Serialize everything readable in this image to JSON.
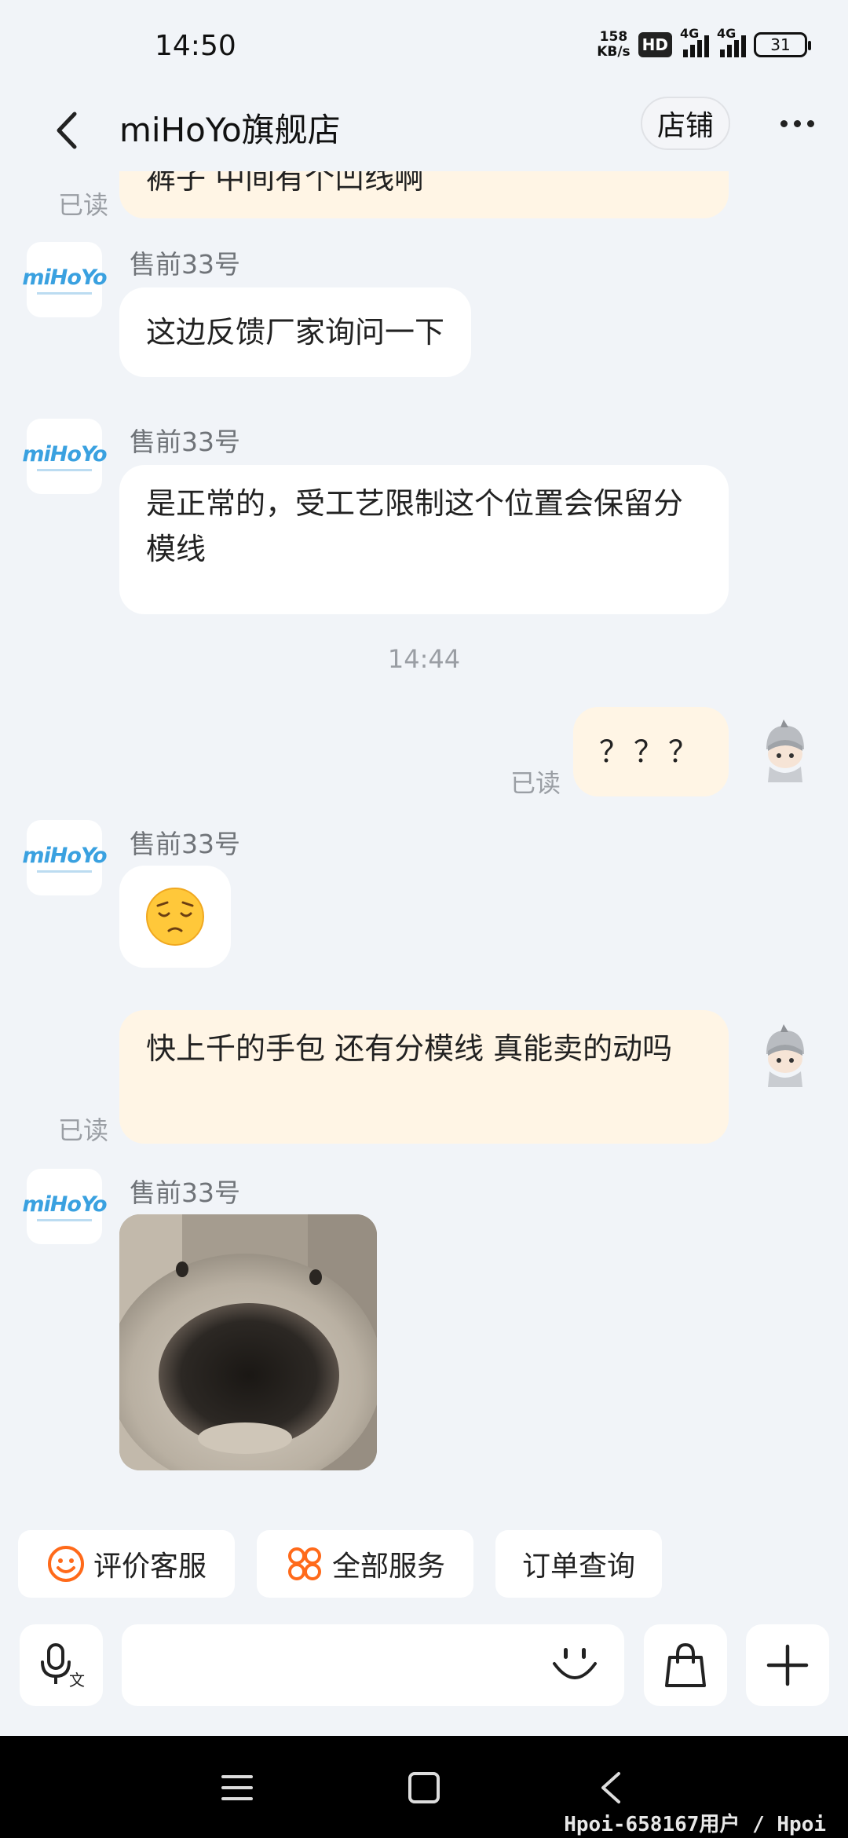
{
  "status_bar": {
    "time": "14:50",
    "net_speed_value": "158",
    "net_speed_unit": "KB/s",
    "hd_label": "HD",
    "network_1": "4G",
    "network_2": "4G",
    "battery": "31"
  },
  "header": {
    "title": "miHoYo旗舰店",
    "store_label": "店铺"
  },
  "chat": {
    "shop_logo_text": "miHoYo",
    "read_label": "已读",
    "messages": [
      {
        "side": "right",
        "text": "裤子 中间有个凹线啊",
        "read": "已读"
      },
      {
        "side": "left",
        "sender": "售前33号",
        "text": "这边反馈厂家询问一下"
      },
      {
        "side": "left",
        "sender": "售前33号",
        "text": "是正常的，受工艺限制这个位置会保留分模线"
      },
      {
        "type": "time",
        "text": "14:44"
      },
      {
        "side": "right",
        "text": "？？？",
        "read": "已读"
      },
      {
        "side": "left",
        "sender": "售前33号",
        "text": "😔"
      },
      {
        "side": "right",
        "text": "快上千的手包 还有分模线 真能卖的动吗",
        "read": "已读"
      },
      {
        "side": "left",
        "sender": "售前33号",
        "image": "dog-nose-photo"
      }
    ]
  },
  "quick_actions": [
    {
      "label": "评价客服",
      "icon": "smile-icon"
    },
    {
      "label": "全部服务",
      "icon": "grid-icon"
    },
    {
      "label": "订单查询"
    }
  ],
  "input_bar": {
    "placeholder": "",
    "voice_icon": "voice-translate-icon",
    "emoji_icon": "emoji-icon",
    "bag_icon": "shopping-bag-icon",
    "plus_icon": "plus-icon"
  },
  "nav_bar": {
    "watermark": "Hpoi-658167用户 / Hpoi"
  },
  "colors": {
    "accent": "#ff6a1a",
    "background": "#f1f4f8",
    "bubble_right": "#fff5e5",
    "bubble_left": "#ffffff"
  }
}
